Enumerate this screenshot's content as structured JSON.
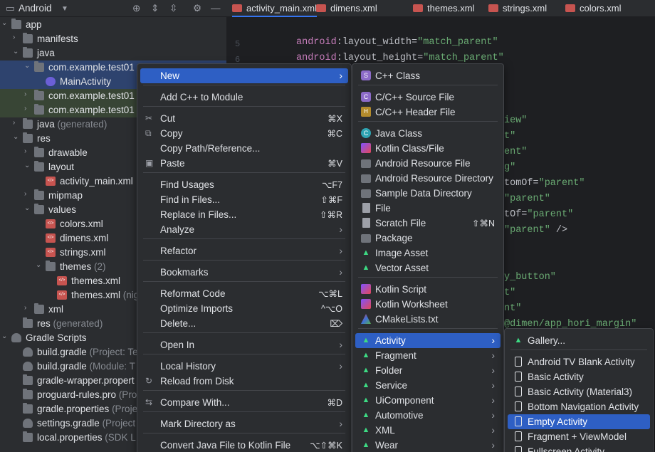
{
  "project_panel": {
    "view_label": "Android",
    "tree": [
      {
        "label": "app",
        "extra": ""
      },
      {
        "label": "manifests",
        "extra": ""
      },
      {
        "label": "java",
        "extra": ""
      },
      {
        "label": "com.example.test01",
        "extra": ""
      },
      {
        "label": "MainActivity",
        "extra": ""
      },
      {
        "label": "com.example.test01",
        "extra": ""
      },
      {
        "label": "com.example.test01",
        "extra": ""
      },
      {
        "label": "java",
        "extra": " (generated)"
      },
      {
        "label": "res",
        "extra": ""
      },
      {
        "label": "drawable",
        "extra": ""
      },
      {
        "label": "layout",
        "extra": ""
      },
      {
        "label": "activity_main.xml",
        "extra": ""
      },
      {
        "label": "mipmap",
        "extra": ""
      },
      {
        "label": "values",
        "extra": ""
      },
      {
        "label": "colors.xml",
        "extra": ""
      },
      {
        "label": "dimens.xml",
        "extra": ""
      },
      {
        "label": "strings.xml",
        "extra": ""
      },
      {
        "label": "themes",
        "extra": " (2)"
      },
      {
        "label": "themes.xml",
        "extra": ""
      },
      {
        "label": "themes.xml",
        "extra": " (nig"
      },
      {
        "label": "xml",
        "extra": ""
      },
      {
        "label": "res",
        "extra": " (generated)"
      },
      {
        "label": "Gradle Scripts",
        "extra": ""
      },
      {
        "label": "build.gradle",
        "extra": " (Project: Te"
      },
      {
        "label": "build.gradle",
        "extra": " (Module: T"
      },
      {
        "label": "gradle-wrapper.propert",
        "extra": ""
      },
      {
        "label": "proguard-rules.pro",
        "extra": " (Pro"
      },
      {
        "label": "gradle.properties",
        "extra": " (Proje"
      },
      {
        "label": "settings.gradle",
        "extra": " (Project"
      },
      {
        "label": "local.properties",
        "extra": " (SDK L"
      }
    ]
  },
  "editor_tabs": [
    "activity_main.xml",
    "dimens.xml",
    "themes.xml",
    "strings.xml",
    "colors.xml"
  ],
  "editor": {
    "line_numbers": [
      "5",
      "6"
    ],
    "lines": [
      {
        "ns": "android",
        "attr": ":layout_width=",
        "str": "\"match_parent\""
      },
      {
        "ns": "android",
        "attr": ":layout_height=",
        "str": "\"match_parent\""
      }
    ],
    "fragments": [
      {
        "text": "iew\"",
        "cls": "str"
      },
      {
        "text": "t\"",
        "cls": "str"
      },
      {
        "text": "ent\"",
        "cls": "str"
      },
      {
        "text": "g\"",
        "cls": "str"
      },
      {
        "text": "tomOf=",
        "cls": "attr",
        "str": "\"parent\""
      },
      {
        "text": "\"parent\"",
        "cls": "str"
      },
      {
        "text": "tOf=",
        "cls": "attr",
        "str": "\"parent\""
      },
      {
        "text": "\"parent\"",
        "cls": "str",
        "tail": " />"
      },
      {
        "text": "y_button\"",
        "cls": "str"
      },
      {
        "text": "t\"",
        "cls": "str"
      },
      {
        "text": "nt\"",
        "cls": "str"
      },
      {
        "text": "@dimen/app_hori_margin\"",
        "cls": "str"
      }
    ]
  },
  "context_menu": {
    "items": [
      {
        "label": "New",
        "shortcut": "",
        "arrow": "›"
      },
      {
        "label": "Add C++ to Module",
        "shortcut": "",
        "arrow": ""
      },
      {
        "label": "Cut",
        "shortcut": "⌘X",
        "arrow": ""
      },
      {
        "label": "Copy",
        "shortcut": "⌘C",
        "arrow": ""
      },
      {
        "label": "Copy Path/Reference...",
        "shortcut": "",
        "arrow": ""
      },
      {
        "label": "Paste",
        "shortcut": "⌘V",
        "arrow": ""
      },
      {
        "label": "Find Usages",
        "shortcut": "⌥F7",
        "arrow": ""
      },
      {
        "label": "Find in Files...",
        "shortcut": "⇧⌘F",
        "arrow": ""
      },
      {
        "label": "Replace in Files...",
        "shortcut": "⇧⌘R",
        "arrow": ""
      },
      {
        "label": "Analyze",
        "shortcut": "",
        "arrow": "›"
      },
      {
        "label": "Refactor",
        "shortcut": "",
        "arrow": "›"
      },
      {
        "label": "Bookmarks",
        "shortcut": "",
        "arrow": "›"
      },
      {
        "label": "Reformat Code",
        "shortcut": "⌥⌘L",
        "arrow": ""
      },
      {
        "label": "Optimize Imports",
        "shortcut": "^⌥O",
        "arrow": ""
      },
      {
        "label": "Delete...",
        "shortcut": "⌦",
        "arrow": ""
      },
      {
        "label": "Open In",
        "shortcut": "",
        "arrow": "›"
      },
      {
        "label": "Local History",
        "shortcut": "",
        "arrow": "›"
      },
      {
        "label": "Reload from Disk",
        "shortcut": "",
        "arrow": ""
      },
      {
        "label": "Compare With...",
        "shortcut": "⌘D",
        "arrow": ""
      },
      {
        "label": "Mark Directory as",
        "shortcut": "",
        "arrow": "›"
      },
      {
        "label": "Convert Java File to Kotlin File",
        "shortcut": "⌥⇧⌘K",
        "arrow": ""
      }
    ]
  },
  "new_menu": {
    "items": [
      {
        "label": "C++ Class",
        "shortcut": "",
        "arrow": ""
      },
      {
        "label": "C/C++ Source File",
        "shortcut": "",
        "arrow": ""
      },
      {
        "label": "C/C++ Header File",
        "shortcut": "",
        "arrow": ""
      },
      {
        "label": "Java Class",
        "shortcut": "",
        "arrow": ""
      },
      {
        "label": "Kotlin Class/File",
        "shortcut": "",
        "arrow": ""
      },
      {
        "label": "Android Resource File",
        "shortcut": "",
        "arrow": ""
      },
      {
        "label": "Android Resource Directory",
        "shortcut": "",
        "arrow": ""
      },
      {
        "label": "Sample Data Directory",
        "shortcut": "",
        "arrow": ""
      },
      {
        "label": "File",
        "shortcut": "",
        "arrow": ""
      },
      {
        "label": "Scratch File",
        "shortcut": "⇧⌘N",
        "arrow": ""
      },
      {
        "label": "Package",
        "shortcut": "",
        "arrow": ""
      },
      {
        "label": "Image Asset",
        "shortcut": "",
        "arrow": ""
      },
      {
        "label": "Vector Asset",
        "shortcut": "",
        "arrow": ""
      },
      {
        "label": "Kotlin Script",
        "shortcut": "",
        "arrow": ""
      },
      {
        "label": "Kotlin Worksheet",
        "shortcut": "",
        "arrow": ""
      },
      {
        "label": "CMakeLists.txt",
        "shortcut": "",
        "arrow": ""
      },
      {
        "label": "Activity",
        "shortcut": "",
        "arrow": "›"
      },
      {
        "label": "Fragment",
        "shortcut": "",
        "arrow": "›"
      },
      {
        "label": "Folder",
        "shortcut": "",
        "arrow": "›"
      },
      {
        "label": "Service",
        "shortcut": "",
        "arrow": "›"
      },
      {
        "label": "UiComponent",
        "shortcut": "",
        "arrow": "›"
      },
      {
        "label": "Automotive",
        "shortcut": "",
        "arrow": "›"
      },
      {
        "label": "XML",
        "shortcut": "",
        "arrow": "›"
      },
      {
        "label": "Wear",
        "shortcut": "",
        "arrow": "›"
      }
    ]
  },
  "activity_menu": {
    "items": [
      {
        "label": "Gallery..."
      },
      {
        "label": "Android TV Blank Activity"
      },
      {
        "label": "Basic Activity"
      },
      {
        "label": "Basic Activity (Material3)"
      },
      {
        "label": "Bottom Navigation Activity"
      },
      {
        "label": "Empty Activity"
      },
      {
        "label": "Fragment + ViewModel"
      },
      {
        "label": "Fullscreen Activity"
      }
    ]
  },
  "colors": {
    "selection": "#2e5fc4",
    "panel": "#2b2d30",
    "editor": "#1e1f22",
    "android_green": "#3ddc84"
  }
}
